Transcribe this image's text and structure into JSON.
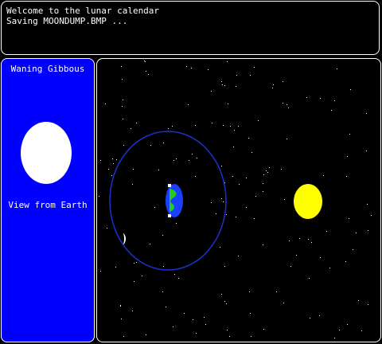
{
  "console": {
    "lines": [
      "Welcome to the lunar calendar",
      "Saving MOONDUMP.BMP ..."
    ]
  },
  "side_panel": {
    "phase_name": "Waning Gibbous",
    "view_caption": "View from Earth",
    "background_color": "#0000ff",
    "moon_color": "#ffffff"
  },
  "space_view": {
    "orbit_color": "#1a33cc",
    "earth_ocean_color": "#1a40ff",
    "earth_land_color": "#22cc22",
    "sun_color": "#ffff00",
    "star_color": "#ffffff"
  }
}
